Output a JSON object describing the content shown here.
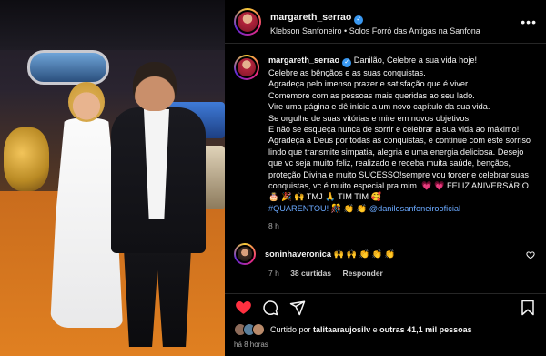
{
  "post": {
    "username": "margareth_serrao",
    "audio": "Klebson Sanfoneiro • Solos Forró das Antigas na Sanfona",
    "more_label": "•••"
  },
  "caption": {
    "username": "margareth_serrao",
    "lines": [
      "Danilão, Celebre a sua vida hoje!",
      "Celebre as bênçãos e as suas conquistas.",
      "Agradeça pelo imenso prazer e satisfação que é viver.",
      "Comemore com as pessoas mais queridas ao seu lado.",
      "Vire uma página e dê início a um novo capítulo da sua vida.",
      "Se orgulhe de suas vitórias e mire em novos objetivos.",
      "E não se esqueça nunca de sorrir e celebrar a sua vida ao máximo! Agradeça a Deus por todas as conquistas, e continue com este sorriso lindo que transmite simpatia, alegria e uma energia deliciosa. Desejo que vc seja muito feliz, realizado e receba muita saúde, bençãos, proteção Divina e muito SUCESSO!sempre vou torcer e celebrar suas conquistas, vc é muito especial pra mim. 💗 💗 FELIZ ANIVERSÁRIO 🎂 🎉 🙌 TMJ 🙏 TIM TIM 🥰"
    ],
    "hashtag": "#QUARENTOU!",
    "hashtag_emoji": "🎊 👏 👏",
    "mention": "@danilosanfoneirooficial",
    "time": "8 h"
  },
  "comment": {
    "username": "soninhaveronica",
    "text": "🙌 🙌 👏 👏 👏",
    "time": "7 h",
    "likes": "38 curtidas",
    "reply": "Responder"
  },
  "likes": {
    "prefix": "Curtido por",
    "user": "talitaaraujosilv",
    "suffix": "e",
    "others": "outras 41,1 mil pessoas"
  },
  "posted": "há 8 horas",
  "colors": {
    "background": "#000000",
    "link": "#6aa9ff",
    "verified": "#3897f0",
    "like_red": "#ff3040"
  },
  "icons": [
    "verified-badge-icon",
    "more-icon",
    "heart-icon",
    "comment-icon",
    "share-icon",
    "bookmark-icon"
  ]
}
